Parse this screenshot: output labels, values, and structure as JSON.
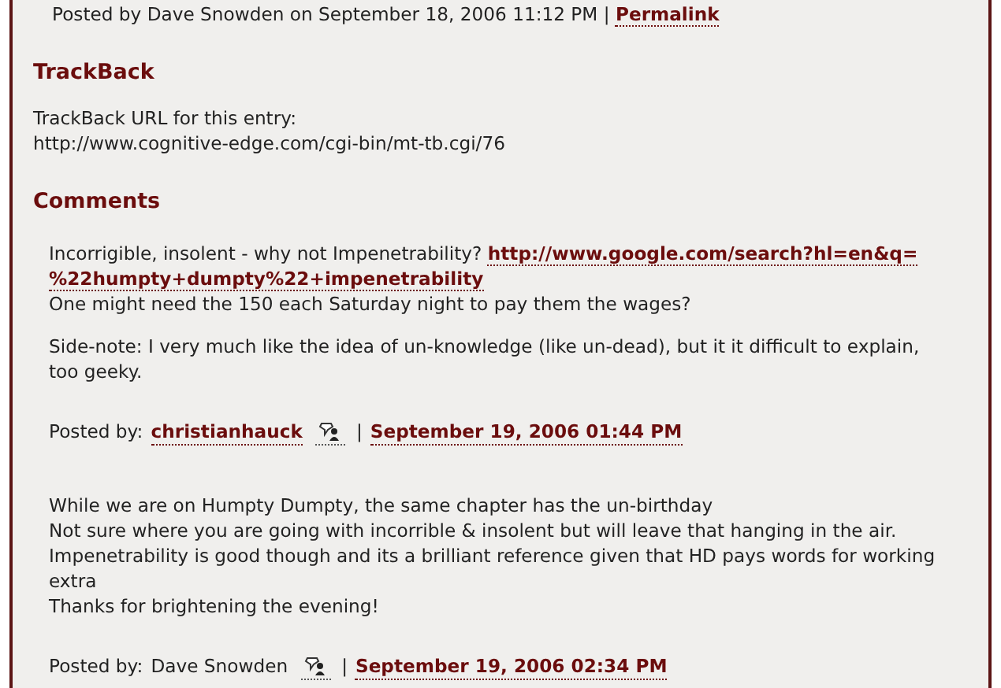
{
  "post_footer": {
    "text": "Posted by Dave Snowden on September 18, 2006 11:12 PM |",
    "permalink": "Permalink"
  },
  "trackback": {
    "heading": "TrackBack",
    "lines": [
      "TrackBack URL for this entry:",
      "http://www.cognitive-edge.com/cgi-bin/mt-tb.cgi/76"
    ]
  },
  "comments": {
    "heading": "Comments",
    "items": [
      {
        "paragraphs": [
          {
            "text": "Incorrigible, insolent - why not Impenetrability?",
            "link_lines": [
              "http://www.google.com/search?hl=en&q=",
              "%22humpty+dumpty%22+impenetrability"
            ],
            "lines": [
              "One might need the 150 each Saturday night to pay them the wages?"
            ]
          },
          {
            "lines": [
              "Side-note: I very much like the idea of un-knowledge (like un-dead), but it it difficult to explain, too geeky."
            ]
          }
        ],
        "posted_label": "Posted by:",
        "author": "christianhauck",
        "kind": "link",
        "separator": "|",
        "date": "September 19, 2006 01:44 PM"
      },
      {
        "paragraphs": [
          {
            "lines": [
              "While we are on Humpty Dumpty, the same chapter has the un-birthday",
              "Not sure where you are going with incorrible & insolent but will leave that hanging in the air.",
              "Impenetrability is good though and its a brilliant reference given that HD pays words for working extra",
              "Thanks for brightening the evening!"
            ]
          }
        ],
        "posted_label": "Posted by:",
        "author": "Dave Snowden",
        "kind": "plain",
        "separator": "|",
        "date": "September 19, 2006 02:34 PM"
      }
    ]
  }
}
